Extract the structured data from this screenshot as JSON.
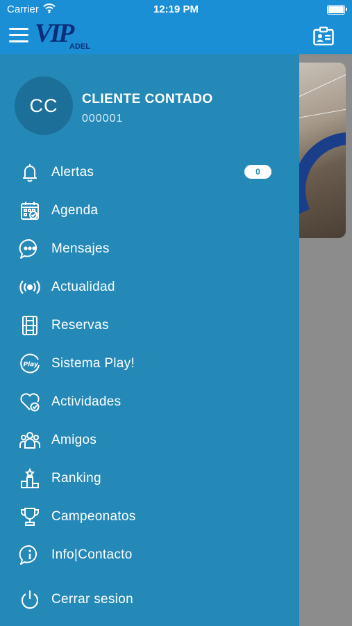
{
  "status_bar": {
    "carrier": "Carrier",
    "time": "12:19 PM"
  },
  "header": {
    "logo_main": "VIP",
    "logo_sub": "ADEL",
    "right_icon": "id-card-icon"
  },
  "profile": {
    "initials": "CC",
    "name": "CLIENTE CONTADO",
    "id": "000001"
  },
  "menu": {
    "items": [
      {
        "label": "Alertas",
        "icon": "bell-icon",
        "badge": "0"
      },
      {
        "label": "Agenda",
        "icon": "calendar-check-icon"
      },
      {
        "label": "Mensajes",
        "icon": "chat-bubble-icon"
      },
      {
        "label": "Actualidad",
        "icon": "broadcast-icon"
      },
      {
        "label": "Reservas",
        "icon": "court-icon"
      },
      {
        "label": "Sistema Play!",
        "icon": "play-badge-icon"
      },
      {
        "label": "Actividades",
        "icon": "heart-check-icon"
      },
      {
        "label": "Amigos",
        "icon": "friends-icon"
      },
      {
        "label": "Ranking",
        "icon": "podium-icon"
      },
      {
        "label": "Campeonatos",
        "icon": "trophy-icon"
      },
      {
        "label": "Info|Contacto",
        "icon": "info-icon"
      }
    ],
    "logout": {
      "label": "Cerrar sesion",
      "icon": "power-icon"
    }
  },
  "colors": {
    "header_bg": "#1a8fd6",
    "drawer_bg": "#2589b8",
    "avatar_bg": "#1c6f99",
    "logo_color": "#0a2e7a"
  }
}
